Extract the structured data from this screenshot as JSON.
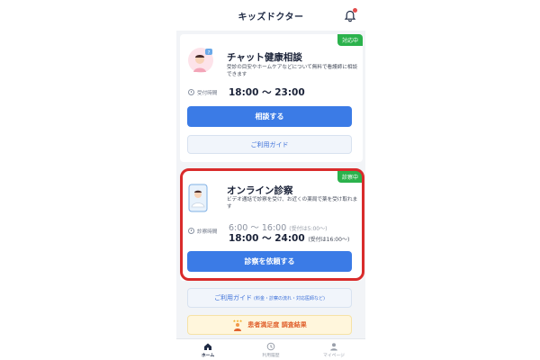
{
  "header": {
    "title": "キッズドクター"
  },
  "chat_card": {
    "status": "対応中",
    "title": "チャット健康相談",
    "description": "受診の目安やホームケアなどについて無料で看護師に相談できます",
    "time_label": "受付時間",
    "time": "18:00 〜 23:00",
    "primary_button": "相談する",
    "guide_button": "ご利用ガイド"
  },
  "online_card": {
    "status": "診察中",
    "title": "オンライン診察",
    "description": "ビデオ通話で診察を受け、お近くの薬局で薬を受け取れます",
    "time_label": "診察時間",
    "time1": "6:00 〜 16:00",
    "time1_note": "(受付は5:00〜)",
    "time2": "18:00 〜 24:00",
    "time2_note": "(受付は16:00〜)",
    "primary_button": "診察を依頼する"
  },
  "guide_detail": {
    "label": "ご利用ガイド",
    "sub": "(料金・診察の流れ・対応医師など)"
  },
  "survey": {
    "label": "患者満足度 調査結果"
  },
  "tabbar": {
    "items": [
      {
        "label": "ホーム",
        "icon": "home-icon"
      },
      {
        "label": "利用履歴",
        "icon": "history-icon"
      },
      {
        "label": "マイページ",
        "icon": "person-icon"
      }
    ]
  },
  "colors": {
    "accent": "#3b7be6",
    "status": "#2bb24c",
    "highlight": "#d92b2b"
  }
}
